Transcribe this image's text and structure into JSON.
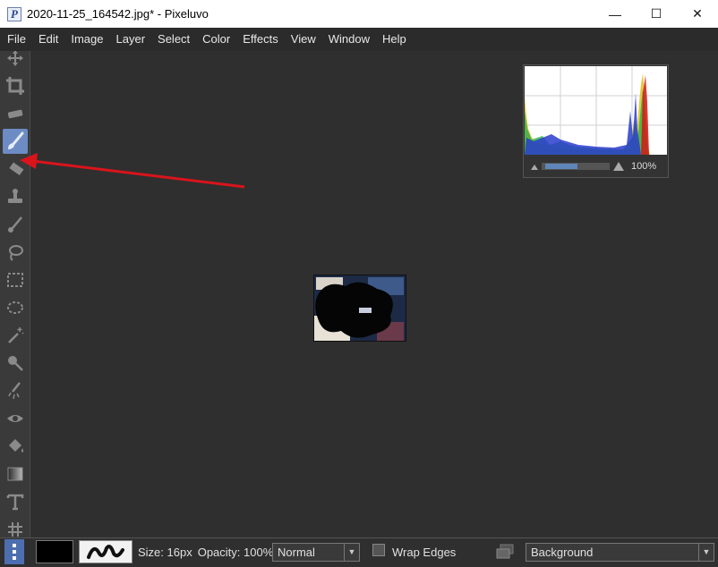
{
  "window": {
    "title": "2020-11-25_164542.jpg* - Pixeluvo",
    "app_icon_letter": "P",
    "minimize": "—",
    "maximize": "☐",
    "close": "✕"
  },
  "menu": [
    "File",
    "Edit",
    "Image",
    "Layer",
    "Select",
    "Color",
    "Effects",
    "View",
    "Window",
    "Help"
  ],
  "toolbar": {
    "active_tool": "brush",
    "tools": [
      "move",
      "crop",
      "straighten",
      "brush",
      "eraser",
      "clone-stamp",
      "healing",
      "lasso",
      "rect-select",
      "ellipse-select",
      "magic-wand",
      "dodge-burn",
      "smudge",
      "red-eye",
      "paint-bucket",
      "gradient",
      "text",
      "warp"
    ]
  },
  "histogram": {
    "zoom": "100%"
  },
  "statusbar": {
    "size": "Size: 16px",
    "opacity": "Opacity: 100%",
    "blend_mode": "Normal",
    "wrap_edges": "Wrap Edges",
    "layer": "Background",
    "primary_color": "#000000"
  },
  "colors": {
    "accent": "#6d8cc4",
    "annotation_arrow": "#d9141b"
  }
}
